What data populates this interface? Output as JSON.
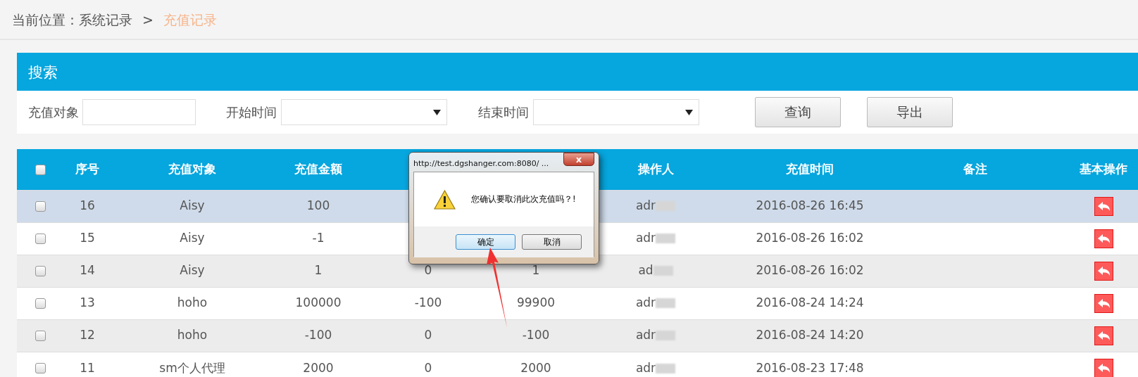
{
  "breadcrumb": {
    "label": "当前位置：",
    "items": [
      {
        "text": "系统记录",
        "selected": false
      },
      {
        "text": "充值记录",
        "selected": true
      }
    ],
    "separator": ">"
  },
  "search": {
    "title": "搜索",
    "fields": [
      {
        "label": "充值对象",
        "kind": "text"
      },
      {
        "label": "开始时间",
        "kind": "select"
      },
      {
        "label": "结束时间",
        "kind": "select"
      }
    ],
    "buttons": [
      "查询",
      "导出"
    ]
  },
  "table": {
    "header": {
      "checked": false,
      "index": "序号",
      "target": "充值对象",
      "amount": "充值金额",
      "operator": "操作人",
      "time": "充值时间",
      "note": "备注",
      "actions": "基本操作"
    },
    "rows": [
      {
        "selected": true,
        "checked": false,
        "index": "16",
        "target": "Aisy",
        "amount": "100",
        "operator": "adr",
        "time": "2016-08-26 16:45"
      },
      {
        "selected": false,
        "checked": false,
        "index": "15",
        "target": "Aisy",
        "amount": "-1",
        "operator": "adr",
        "time": "2016-08-26 16:02"
      },
      {
        "selected": false,
        "checked": false,
        "index": "14",
        "target": "Aisy",
        "amount": "1",
        "column_5": "0",
        "column_6": "1",
        "operator": "ad",
        "time": "2016-08-26 16:02"
      },
      {
        "selected": false,
        "checked": false,
        "index": "13",
        "target": "hoho",
        "amount": "100000",
        "column_5": "-100",
        "column_6": "99900",
        "operator": "adr",
        "time": "2016-08-24 14:24"
      },
      {
        "selected": false,
        "checked": false,
        "index": "12",
        "target": "hoho",
        "amount": "-100",
        "column_5": "0",
        "column_6": "-100",
        "operator": "adr",
        "time": "2016-08-24 14:20"
      },
      {
        "selected": false,
        "checked": false,
        "index": "11",
        "target": "sm个人代理",
        "amount": "2000",
        "column_5": "0",
        "column_6": "2000",
        "operator": "adr",
        "time": "2016-08-23 17:48"
      }
    ]
  },
  "dialog": {
    "title": "http://test.dgshanger.com:8080/ ...",
    "close": "x",
    "message": "您确认要取消此次充值吗？!",
    "buttons": [
      {
        "label": "确定",
        "selected": true
      },
      {
        "label": "取消",
        "selected": false
      }
    ]
  }
}
